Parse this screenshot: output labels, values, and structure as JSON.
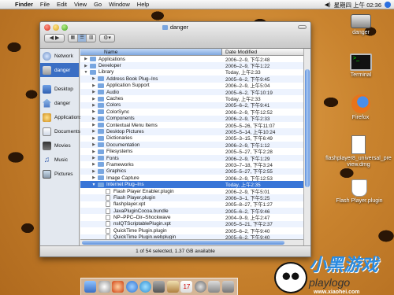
{
  "menubar": {
    "apple": "",
    "app": "Finder",
    "items": [
      "File",
      "Edit",
      "View",
      "Go",
      "Window",
      "Help"
    ],
    "clock": "星期四 上午 02:36"
  },
  "window": {
    "title": "danger",
    "back_forward": "◀ ▶",
    "status": "1 of 54 selected, 1.37 GB available"
  },
  "sidebar": {
    "items": [
      {
        "label": "Network",
        "icon": "network-icon"
      },
      {
        "label": "danger",
        "icon": "hard-drive-icon",
        "selected": true
      }
    ],
    "places": [
      {
        "label": "Desktop",
        "icon": "desktop-icon"
      },
      {
        "label": "danger",
        "icon": "home-icon"
      },
      {
        "label": "Applications",
        "icon": "applications-icon"
      },
      {
        "label": "Documents",
        "icon": "documents-icon"
      },
      {
        "label": "Movies",
        "icon": "movies-icon"
      },
      {
        "label": "Music",
        "icon": "music-icon"
      },
      {
        "label": "Pictures",
        "icon": "pictures-icon"
      }
    ]
  },
  "list": {
    "col_name": "Name",
    "col_date": "Date Modified",
    "rows": [
      {
        "name": "Applications",
        "date": "2006–2–9, 下午2:48",
        "level": 0,
        "tri": "▶",
        "kind": "folder"
      },
      {
        "name": "Developer",
        "date": "2006–2–9, 下午1:22",
        "level": 0,
        "tri": "▶",
        "kind": "folder"
      },
      {
        "name": "Library",
        "date": "Today, 上午2:33",
        "level": 0,
        "tri": "▼",
        "kind": "folder"
      },
      {
        "name": "Address Book Plug–Ins",
        "date": "2005–6–2, 下午9:45",
        "level": 1,
        "tri": "▶",
        "kind": "folder"
      },
      {
        "name": "Application Support",
        "date": "2006–2–9, 上午5:04",
        "level": 1,
        "tri": "▶",
        "kind": "folder"
      },
      {
        "name": "Audio",
        "date": "2005–6–2, 下午10:19",
        "level": 1,
        "tri": "▶",
        "kind": "folder"
      },
      {
        "name": "Caches",
        "date": "Today, 上午2:33",
        "level": 1,
        "tri": "▶",
        "kind": "folder"
      },
      {
        "name": "Colors",
        "date": "2005–6–2, 下午9:41",
        "level": 1,
        "tri": "▶",
        "kind": "folder"
      },
      {
        "name": "ColorSync",
        "date": "2006–2–9, 下午12:52",
        "level": 1,
        "tri": "▶",
        "kind": "folder"
      },
      {
        "name": "Components",
        "date": "2006–2–9, 下午2:33",
        "level": 1,
        "tri": "▶",
        "kind": "folder"
      },
      {
        "name": "Contextual Menu Items",
        "date": "2005–5–26, 下午11:07",
        "level": 1,
        "tri": "▶",
        "kind": "folder"
      },
      {
        "name": "Desktop Pictures",
        "date": "2005–5–14, 上午10:24",
        "level": 1,
        "tri": "▶",
        "kind": "folder"
      },
      {
        "name": "Dictionaries",
        "date": "2005–3–15, 下午6:49",
        "level": 1,
        "tri": "▶",
        "kind": "folder"
      },
      {
        "name": "Documentation",
        "date": "2006–2–9, 下午1:12",
        "level": 1,
        "tri": "▶",
        "kind": "folder"
      },
      {
        "name": "Filesystems",
        "date": "2005–5–27, 下午2:28",
        "level": 1,
        "tri": "▶",
        "kind": "folder"
      },
      {
        "name": "Fonts",
        "date": "2006–2–9, 下午1:29",
        "level": 1,
        "tri": "▶",
        "kind": "folder"
      },
      {
        "name": "Frameworks",
        "date": "2003–7–18, 下午3:24",
        "level": 1,
        "tri": "▶",
        "kind": "folder"
      },
      {
        "name": "Graphics",
        "date": "2005–5–27, 下午2:55",
        "level": 1,
        "tri": "▶",
        "kind": "folder"
      },
      {
        "name": "Image Capture",
        "date": "2006–2–9, 下午12:53",
        "level": 1,
        "tri": "▶",
        "kind": "folder"
      },
      {
        "name": "Internet Plug–Ins",
        "date": "Today, 上午2:35",
        "level": 1,
        "tri": "▼",
        "kind": "folder",
        "selected": true
      },
      {
        "name": "Flash Player Enabler.plugin",
        "date": "2006–2–9, 下午5:01",
        "level": 2,
        "tri": "",
        "kind": "file"
      },
      {
        "name": "Flash Player.plugin",
        "date": "2006–3–1, 下午5:25",
        "level": 2,
        "tri": "",
        "kind": "file"
      },
      {
        "name": "flashplayer.xpt",
        "date": "2005–8–27, 下午1:27",
        "level": 2,
        "tri": "",
        "kind": "file"
      },
      {
        "name": "JavaPluginCocoa.bundle",
        "date": "2005–6–2, 下午9:46",
        "level": 2,
        "tri": "",
        "kind": "file"
      },
      {
        "name": "NP–PPC–Dir–Shockwave",
        "date": "2004–9–9, 上午2:47",
        "level": 2,
        "tri": "",
        "kind": "file"
      },
      {
        "name": "nsIQTScriptablePlugin.xpt",
        "date": "2005–5–21, 下午2:37",
        "level": 2,
        "tri": "",
        "kind": "file"
      },
      {
        "name": "QuickTime Plugin.plugin",
        "date": "2005–6–2, 下午9:40",
        "level": 2,
        "tri": "",
        "kind": "file"
      },
      {
        "name": "QuickTime Plugin.webplugin",
        "date": "2005–6–2, 下午9:40",
        "level": 2,
        "tri": "",
        "kind": "file"
      }
    ]
  },
  "desktop": {
    "icons": [
      {
        "label": "danger",
        "icon": "hard-drive-icon"
      },
      {
        "label": "Terminal",
        "icon": "terminal-icon"
      },
      {
        "label": "Firefox",
        "icon": "firefox-icon"
      },
      {
        "label": "flashplayer8_universal_preview.dmg",
        "icon": "disk-image-icon"
      },
      {
        "label": "Flash Player.plugin",
        "icon": "plugin-icon"
      }
    ]
  },
  "watermark": {
    "text": "小黑游戏",
    "text2": "playlogo",
    "url": "www.xiaohei.com"
  }
}
